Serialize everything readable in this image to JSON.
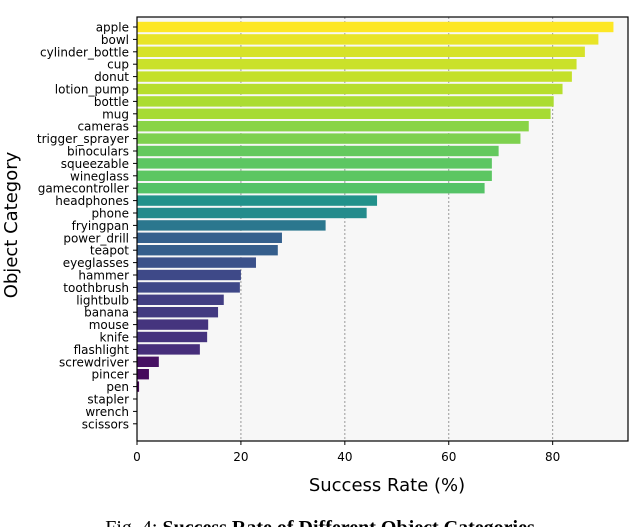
{
  "chart_data": {
    "type": "bar",
    "orientation": "horizontal",
    "categories": [
      "apple",
      "bowl",
      "cylinder_bottle",
      "cup",
      "donut",
      "lotion_pump",
      "bottle",
      "mug",
      "cameras",
      "trigger_sprayer",
      "binoculars",
      "squeezable",
      "wineglass",
      "gamecontroller",
      "headphones",
      "phone",
      "fryingpan",
      "power_drill",
      "teapot",
      "eyeglasses",
      "hammer",
      "toothbrush",
      "lightbulb",
      "banana",
      "mouse",
      "knife",
      "flashlight",
      "screwdriver",
      "pincer",
      "pen",
      "stapler",
      "wrench",
      "scissors"
    ],
    "values": [
      91.7,
      88.8,
      86.2,
      84.6,
      83.7,
      81.9,
      80.2,
      79.6,
      75.4,
      73.8,
      69.6,
      68.3,
      68.3,
      66.9,
      46.2,
      44.2,
      36.3,
      27.9,
      27.1,
      22.9,
      20.0,
      19.8,
      16.7,
      15.6,
      13.7,
      13.5,
      12.1,
      4.2,
      2.3,
      0.4,
      0,
      0,
      0
    ],
    "xlabel": "Success Rate (%)",
    "ylabel": "Object Category",
    "xlim": [
      0,
      94.5
    ],
    "xticks": [
      "0",
      "20",
      "40",
      "60",
      "80"
    ],
    "grid": "vertical dotted",
    "colormap": "viridis",
    "background": "#f7f7f7"
  },
  "caption": {
    "prefix": "Fig. 4:",
    "text_bold": "Success Rate of Different Object Categories"
  }
}
